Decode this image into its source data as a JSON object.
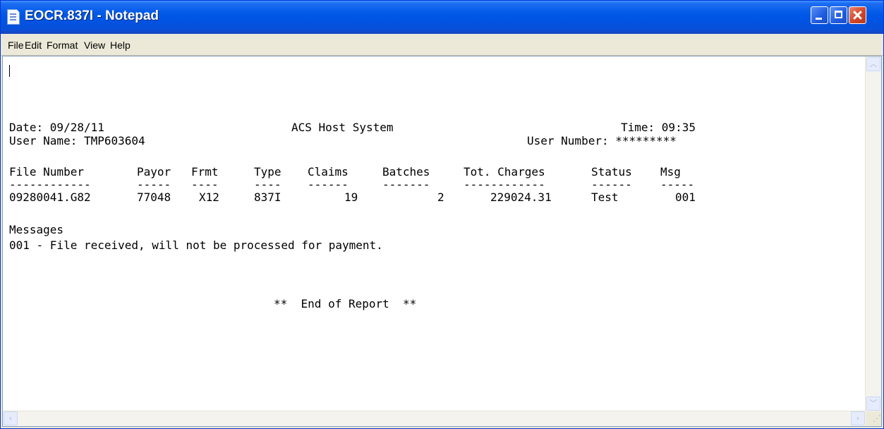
{
  "window": {
    "title": "EOCR.837I - Notepad",
    "icon": "notepad-icon",
    "controls": [
      "minimize-icon",
      "maximize-icon",
      "close-icon"
    ]
  },
  "menu": {
    "items": [
      "File",
      "Edit",
      "Format",
      "View",
      "Help"
    ]
  },
  "report": {
    "date_label": "Date: 09/28/11",
    "system_name": "ACS Host System",
    "time_label": "Time: 09:35",
    "user_name_label": "User Name: TMP603604",
    "user_number_label": "User Number: *********",
    "columns": [
      "File Number",
      "Payor",
      "Frmt",
      "Type",
      "Claims",
      "Batches",
      "Tot. Charges",
      "Status",
      "Msg"
    ],
    "separators": [
      "------------",
      "-----",
      "----",
      "----",
      "------",
      "-------",
      "------------",
      "------",
      "-----"
    ],
    "rows": [
      [
        "09280041.G82",
        "77048",
        "X12",
        "837I",
        "19",
        "2",
        "229024.31",
        "Test",
        "001"
      ]
    ],
    "messages_heading": "Messages",
    "messages": [
      "001 - File received, will not be processed for payment."
    ],
    "end_marker": "**  End of Report  **"
  }
}
